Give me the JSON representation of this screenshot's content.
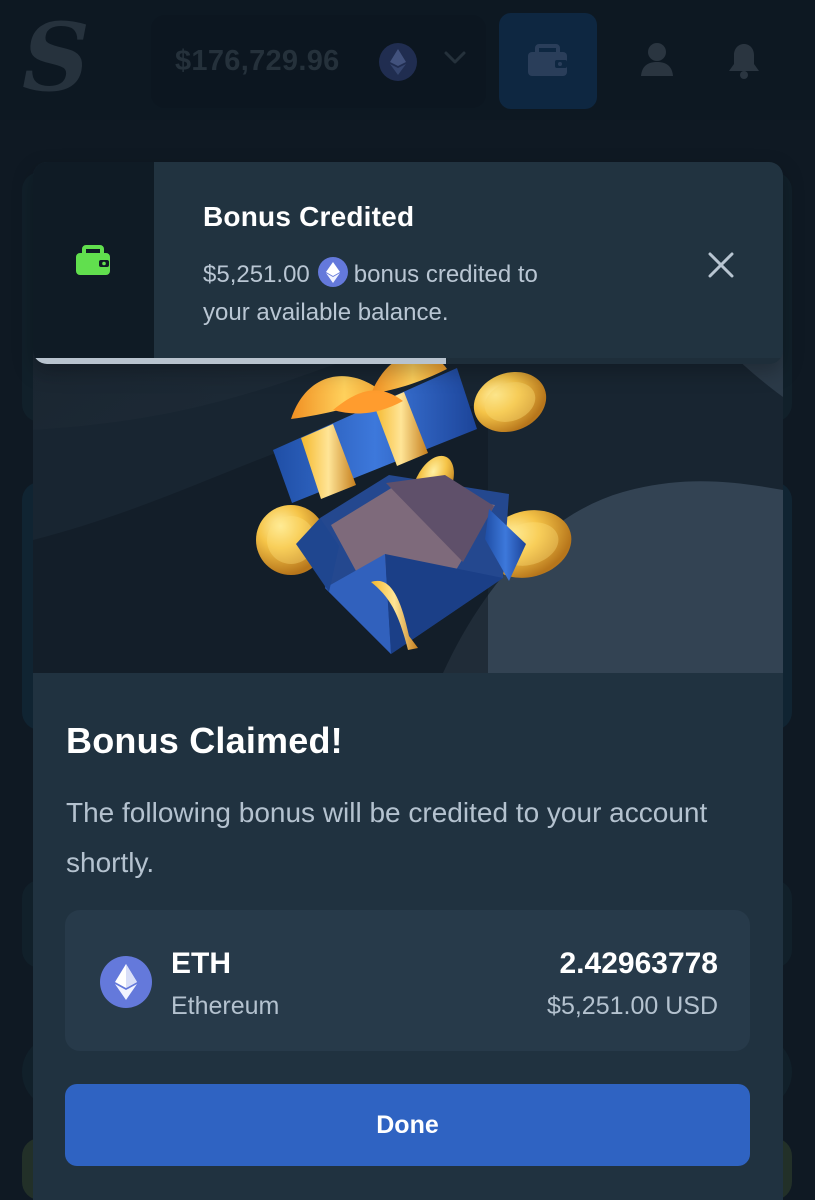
{
  "header": {
    "logo_letter": "S",
    "balance": "$176,729.96",
    "balance_currency_icon": "ethereum-icon",
    "dropdown_icon": "chevron-down-icon",
    "wallet_icon": "wallet-icon",
    "user_icon": "user-icon",
    "notifications_icon": "bell-icon"
  },
  "toast": {
    "icon": "wallet-icon",
    "title": "Bonus Credited",
    "amount": "$5,251.00",
    "message_suffix": "bonus credited to",
    "message_line2": "your available balance.",
    "close_icon": "close-icon",
    "progress_percent": 55
  },
  "modal": {
    "title": "Bonus Claimed!",
    "description": "The following bonus will be credited to your account shortly.",
    "asset": {
      "icon": "ethereum-icon",
      "symbol": "ETH",
      "name": "Ethereum",
      "amount": "2.42963778",
      "usd_value": "$5,251.00 USD"
    },
    "done_label": "Done"
  },
  "colors": {
    "page_background": "#0f1923",
    "modal_background": "#203240",
    "asset_card": "#273a4a",
    "primary_button": "#2f63c2",
    "wallet_green": "#61df4e",
    "ethereum_purple": "#6479db",
    "gift_blue": "#2656b8",
    "coin_gold": "#f0b537"
  }
}
